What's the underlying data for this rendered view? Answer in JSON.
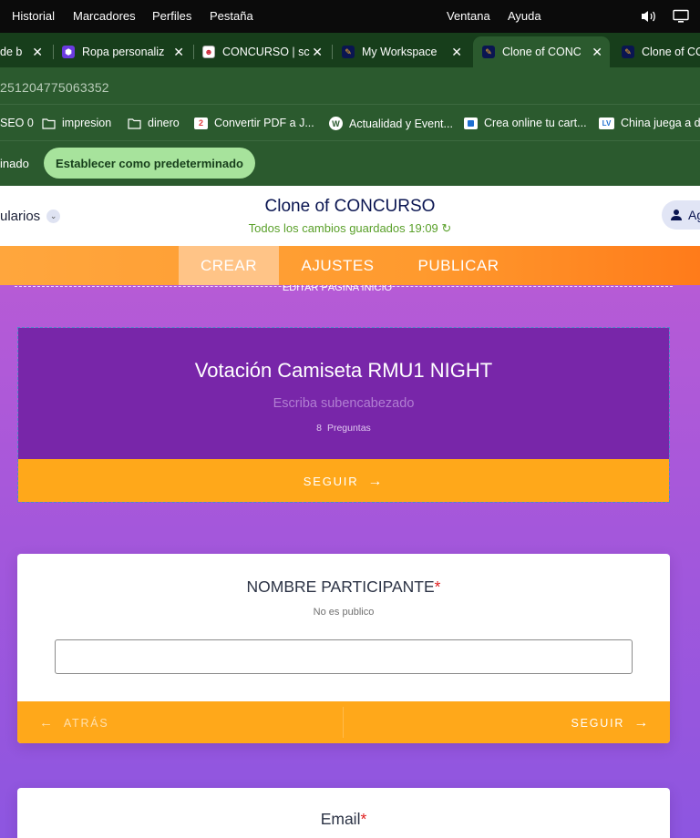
{
  "menubar": {
    "items": [
      "Historial",
      "Marcadores",
      "Perfiles",
      "Pestaña"
    ],
    "right_items": [
      "Ventana",
      "Ayuda"
    ],
    "icons": [
      "speaker-icon",
      "display-icon"
    ]
  },
  "tabs": [
    {
      "title": "de b",
      "fav_color": "#2b5a2e"
    },
    {
      "title": "Ropa personaliz",
      "fav_color": "#6b3be0"
    },
    {
      "title": "CONCURSO | sc",
      "fav_color": "#ffffff"
    },
    {
      "title": "My Workspace",
      "fav_color": "#0a1551"
    },
    {
      "title": "Clone of CONC",
      "fav_color": "#0a1551",
      "active": true
    },
    {
      "title": "Clone of CC",
      "fav_color": "#0a1551"
    }
  ],
  "address": {
    "url": "25120477506335​2"
  },
  "bookmarks": [
    {
      "label": "SEO 0",
      "icon": "none"
    },
    {
      "label": "impresion",
      "icon": "folder-icon"
    },
    {
      "label": "dinero",
      "icon": "folder-icon"
    },
    {
      "label": "Convertir PDF a J...",
      "icon": "pdf-badge-icon"
    },
    {
      "label": "Actualidad y Event...",
      "icon": "wordpress-icon"
    },
    {
      "label": "Crea online tu cart...",
      "icon": "square-logo-icon"
    },
    {
      "label": "China juega a do",
      "icon": "lv-icon",
      "badge": "LV"
    }
  ],
  "infobar": {
    "label": "inado",
    "button": "Establecer como predeterminado"
  },
  "app": {
    "forms_label": "ularios",
    "title": "Clone of CONCURSO",
    "saved": "Todos los cambios guardados 19:09",
    "user_label": "Ag"
  },
  "nav": {
    "tabs": [
      "CREAR",
      "AJUSTES",
      "PUBLICAR"
    ],
    "active": "CREAR"
  },
  "canvas": {
    "edit_start": "EDITAR PÁGINA INICIO",
    "welcome": {
      "title": "Votación Camiseta RMU1 NIGHT",
      "subtitle": "Escriba subencabezado",
      "count_num": "8",
      "count_label": "Preguntas",
      "next": "SEGUIR"
    },
    "question1": {
      "label": "NOMBRE PARTICIPANTE",
      "required": "*",
      "sublabel": "No es publico",
      "value": "",
      "back": "ATRÁS",
      "next": "SEGUIR"
    },
    "question2": {
      "label": "Email",
      "required": "*"
    }
  }
}
